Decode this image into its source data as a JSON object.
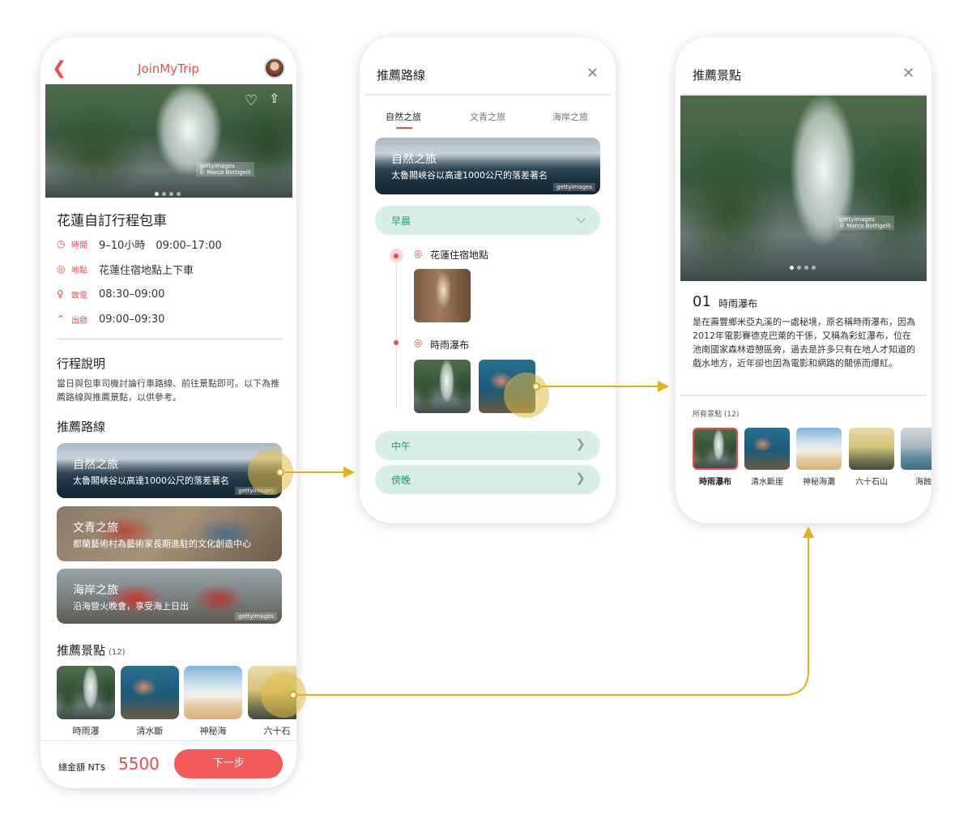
{
  "colors": {
    "accent": "#ea4c4c",
    "green": "#1e9a76",
    "green_bg": "#d8efe7",
    "flow": "#e2b21e"
  },
  "phone1": {
    "app_title": "JoinMyTrip",
    "trip_title": "花蓮自訂行程包車",
    "info": [
      {
        "icon": "clock-icon",
        "label": "時間",
        "value": "9–10小時　09:00–17:00"
      },
      {
        "icon": "map-pin-icon",
        "label": "地點",
        "value": "花蓮住宿地點上下車"
      },
      {
        "icon": "user-icon",
        "label": "致電",
        "value": "08:30–09:00"
      },
      {
        "icon": "car-icon",
        "label": "出發",
        "value": "09:00–09:30"
      }
    ],
    "itinerary_title": "行程說明",
    "itinerary_desc": "當日與包車司機討論行車路線、前往景點即可。以下為推薦路線與推薦景點，以供參考。",
    "routes_title": "推薦路線",
    "routes": [
      {
        "title": "自然之旅",
        "subtitle": "太魯閣峽谷以高達1000公尺的落差著名",
        "credit": "gettyimages"
      },
      {
        "title": "文青之旅",
        "subtitle": "都蘭藝術村為藝術家長期進駐的文化創造中心",
        "credit": ""
      },
      {
        "title": "海岸之旅",
        "subtitle": "沿海營火晚會，享受海上日出",
        "credit": "gettyimages"
      }
    ],
    "spots_title": "推薦景點",
    "spots_count": "(12)",
    "spots": [
      "時雨瀑",
      "清水斷",
      "神秘海",
      "六十石"
    ],
    "total_label": "總金額 NT$",
    "total_value": "5500",
    "next_label": "下一步",
    "hero_credit": "gettyimages",
    "hero_credit_sub": "© Marco Bottigelli"
  },
  "phone2": {
    "title": "推薦路線",
    "tabs": [
      "自然之旅",
      "文青之旅",
      "海岸之旅"
    ],
    "banner_title": "自然之旅",
    "banner_subtitle": "太魯閣峽谷以高達1000公尺的落差著名",
    "banner_credit": "gettyimages",
    "morning_label": "早晨",
    "stops": [
      "花蓮住宿地點",
      "時雨瀑布"
    ],
    "noon_label": "中午",
    "evening_label": "傍晚"
  },
  "phone3": {
    "title": "推薦景點",
    "spot_number": "01",
    "spot_name": "時雨瀑布",
    "spot_desc": "是在壽豐鄉米亞丸溪的一處秘境，原名稱時雨瀑布，因為2012年電影賽德克巴萊的干係，又稱為彩虹瀑布，位在池南國家森林遊憩區旁，過去是許多只有在地人才知道的戲水地方，近年卻也因為電影和網路的關係而爆紅。",
    "all_label": "所有景點",
    "all_count": "(12)",
    "spots": [
      "時雨瀑布",
      "清水斷崖",
      "神秘海灘",
      "六十石山",
      "海蝕"
    ],
    "hero_credit": "gettyimages",
    "hero_credit_sub": "© Marco Bottigelli"
  }
}
